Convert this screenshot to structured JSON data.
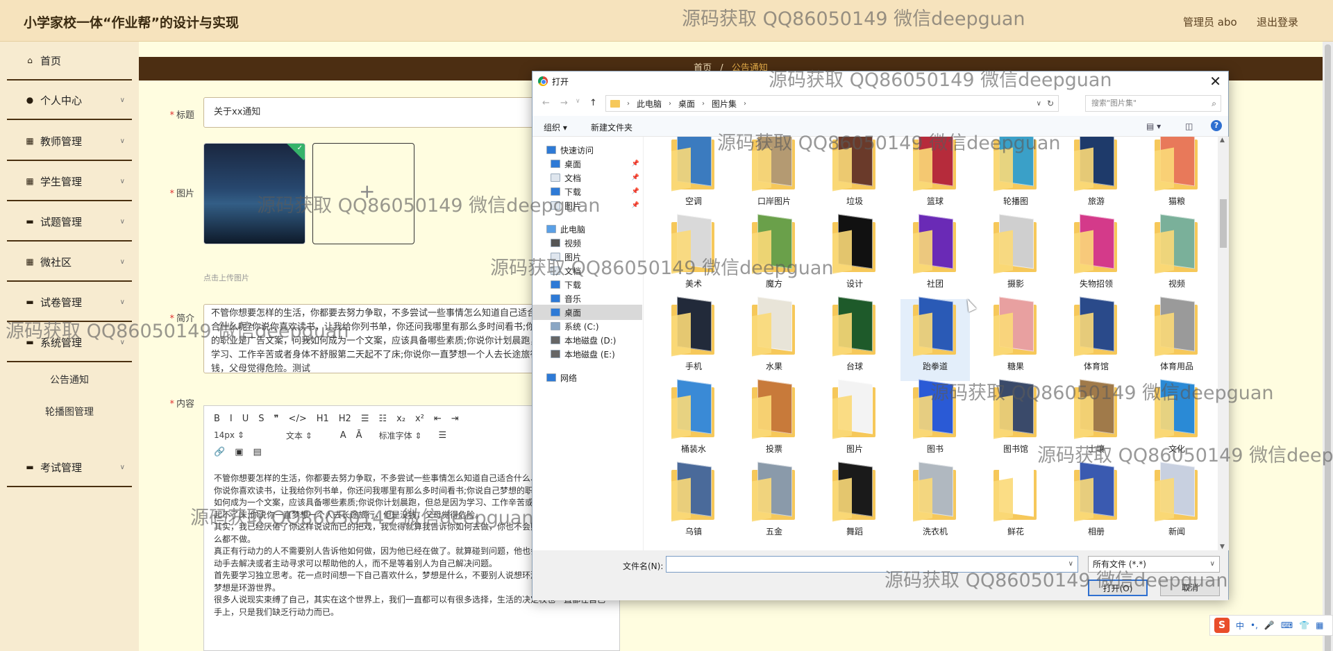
{
  "header": {
    "title": "小学家校一体“作业帮”的设计与实现",
    "admin": "管理员 abo",
    "logout": "退出登录"
  },
  "sidebar": {
    "items": [
      {
        "label": "首页",
        "icon": "home-icon"
      },
      {
        "label": "个人中心",
        "icon": "user-icon"
      },
      {
        "label": "教师管理",
        "icon": "grid-icon"
      },
      {
        "label": "学生管理",
        "icon": "grid-icon"
      },
      {
        "label": "试题管理",
        "icon": "tray-icon"
      },
      {
        "label": "微社区",
        "icon": "grid-icon"
      },
      {
        "label": "试卷管理",
        "icon": "tray-icon"
      },
      {
        "label": "系统管理",
        "icon": "tray-icon"
      },
      {
        "label": "考试管理",
        "icon": "chat-icon"
      }
    ],
    "subitems": [
      "公告通知",
      "轮播图管理"
    ]
  },
  "breadcrumb": {
    "home": "首页",
    "sep": "/",
    "current": "公告通知"
  },
  "form": {
    "title_label": "标题",
    "title_value": "关于xx通知",
    "image_label": "图片",
    "upload_hint": "点击上传图片",
    "intro_label": "简介",
    "intro_value": "不管你想要怎样的生活，你都要去努力争取，不多尝试一些事情怎么知道自己适合什么、不适合什么呢?你说你喜欢读书，让我给你列书单，你还问我哪里有那么多时间看书;你说自己梦想的职业是广告文案，问我如何成为一个文案，应该具备哪些素质;你说你计划晨跑，但总是因为学习、工作辛苦或者身体不舒服第二天起不了床;你说你一直梦想一个人去长途旅行，但是没钱，父母觉得危险。测试",
    "content_label": "内容"
  },
  "editor": {
    "toolbar1": [
      "B",
      "I",
      "U",
      "S",
      "❞",
      "</>",
      "H1",
      "H2",
      "☰",
      "☷",
      "x₂",
      "x²",
      "⇤",
      "⇥"
    ],
    "font_size": "14px",
    "font_type": "文本",
    "font_family": "标准字体",
    "paragraphs": [
      "不管你想要怎样的生活，你都要去努力争取，不多尝试一些事情怎么知道自己适合什么、不适合什么呢?",
      "你说你喜欢读书，让我给你列书单，你还问我哪里有那么多时间看书;你说自己梦想的职业是广告文案，问我如何成为一个文案，应该具备哪些素质;你说你计划晨跑，但总是因为学习、工作辛苦或者身体不舒服第二天起不了床;你说你一直梦想一个人去长途旅行，但是没钱，父母觉得危险。",
      "其实，我已经厌倦了你这样说说而已的把戏，我觉得就算我告诉你如何去做，你也不会照做，因为你根本什么都不做。",
      "真正有行动力的人不需要别人告诉他如何做，因为他已经在做了。就算碰到问题，他也会自己想办法，自己动手去解决或者主动寻求可以帮助他的人，而不是等着别人为自己解决问题。",
      "首先要学习独立思考。花一点时间想一下自己喜欢什么，梦想是什么，不要别人说想环游世界，你就说你的梦想是环游世界。",
      "很多人说现实束缚了自己，其实在这个世界上，我们一直都可以有很多选择，生活的决定权也一直都在自己手上，只是我们缺乏行动力而已。"
    ]
  },
  "dialog": {
    "title": "打开",
    "address": [
      "此电脑",
      "桌面",
      "图片集"
    ],
    "search_placeholder": "搜索\"图片集\"",
    "organize": "组织 ▾",
    "new_folder": "新建文件夹",
    "help": "?",
    "nav": [
      {
        "label": "快速访问",
        "indent": 0,
        "icon_color": "#2e7ad6",
        "pin": false
      },
      {
        "label": "桌面",
        "indent": 1,
        "icon_color": "#2e7ad6",
        "pin": true
      },
      {
        "label": "文档",
        "indent": 1,
        "icon_color": "#dfe6ee",
        "pin": true
      },
      {
        "label": "下载",
        "indent": 1,
        "icon_color": "#2e7ad6",
        "pin": true
      },
      {
        "label": "图片",
        "indent": 1,
        "icon_color": "#dfe6ee",
        "pin": true
      },
      {
        "label": "此电脑",
        "indent": 0,
        "icon_color": "#5aa0e6",
        "pin": false
      },
      {
        "label": "视频",
        "indent": 1,
        "icon_color": "#555",
        "pin": false
      },
      {
        "label": "图片",
        "indent": 1,
        "icon_color": "#dfe6ee",
        "pin": false
      },
      {
        "label": "文档",
        "indent": 1,
        "icon_color": "#dfe6ee",
        "pin": false
      },
      {
        "label": "下载",
        "indent": 1,
        "icon_color": "#2e7ad6",
        "pin": false
      },
      {
        "label": "音乐",
        "indent": 1,
        "icon_color": "#2e7ad6",
        "pin": false
      },
      {
        "label": "桌面",
        "indent": 1,
        "icon_color": "#2e7ad6",
        "pin": false
      },
      {
        "label": "系统 (C:)",
        "indent": 1,
        "icon_color": "#8aa6c4",
        "pin": false
      },
      {
        "label": "本地磁盘 (D:)",
        "indent": 1,
        "icon_color": "#666",
        "pin": false
      },
      {
        "label": "本地磁盘 (E:)",
        "indent": 1,
        "icon_color": "#666",
        "pin": false
      },
      {
        "label": "网络",
        "indent": 0,
        "icon_color": "#2e7ad6",
        "pin": false
      }
    ],
    "selected_nav": 11,
    "folders": [
      {
        "name": "空调",
        "color": "#3b7bbf"
      },
      {
        "name": "口岸图片",
        "color": "#b49a72"
      },
      {
        "name": "垃圾",
        "color": "#6a3a2a"
      },
      {
        "name": "篮球",
        "color": "#b62b3b"
      },
      {
        "name": "轮播图",
        "color": "#3aa0c8"
      },
      {
        "name": "旅游",
        "color": "#1e3a6a"
      },
      {
        "name": "猫粮",
        "color": "#e8795a"
      },
      {
        "name": "美术",
        "color": "#d9d9d9"
      },
      {
        "name": "魔方",
        "color": "#6aa04a"
      },
      {
        "name": "设计",
        "color": "#111111"
      },
      {
        "name": "社团",
        "color": "#6a2ab6"
      },
      {
        "name": "摄影",
        "color": "#cfcfcf"
      },
      {
        "name": "失物招领",
        "color": "#d43a8a"
      },
      {
        "name": "视频",
        "color": "#7ab09a"
      },
      {
        "name": "手机",
        "color": "#222a3a"
      },
      {
        "name": "水果",
        "color": "#e8e4d8"
      },
      {
        "name": "台球",
        "color": "#1e5a2a"
      },
      {
        "name": "跆拳道",
        "color": "#2a5ab6"
      },
      {
        "name": "糖果",
        "color": "#e8a0a0"
      },
      {
        "name": "体育馆",
        "color": "#2a4a8a"
      },
      {
        "name": "体育用品",
        "color": "#9a9a9a"
      },
      {
        "name": "桶装水",
        "color": "#3a8ad6"
      },
      {
        "name": "投票",
        "color": "#c87a3a"
      },
      {
        "name": "图片",
        "color": "#f3f3f3"
      },
      {
        "name": "图书",
        "color": "#2a5ad6"
      },
      {
        "name": "图书馆",
        "color": "#3a4a6a"
      },
      {
        "name": "土壤",
        "color": "#a07a4a"
      },
      {
        "name": "文化",
        "color": "#2a8ad6"
      },
      {
        "name": "乌镇",
        "color": "#4a6a9a"
      },
      {
        "name": "五金",
        "color": "#8a9aaa"
      },
      {
        "name": "舞蹈",
        "color": "#1a1a1a"
      },
      {
        "name": "洗衣机",
        "color": "#b0b8c0"
      },
      {
        "name": "鲜花",
        "color": "#ffffff"
      },
      {
        "name": "相册",
        "color": "#3a5ab0"
      },
      {
        "name": "新闻",
        "color": "#c8d0e0"
      }
    ],
    "selected_folder": 17,
    "filename_label": "文件名(N):",
    "filetype": "所有文件 (*.*)",
    "open_button": "打开(O)",
    "cancel_button": "取消"
  },
  "watermark": "源码获取 QQ86050149 微信deepguan",
  "ime": {
    "logo": "S",
    "items": [
      "中",
      "•,",
      "🎤",
      "⌨",
      "👕",
      "▦"
    ]
  }
}
